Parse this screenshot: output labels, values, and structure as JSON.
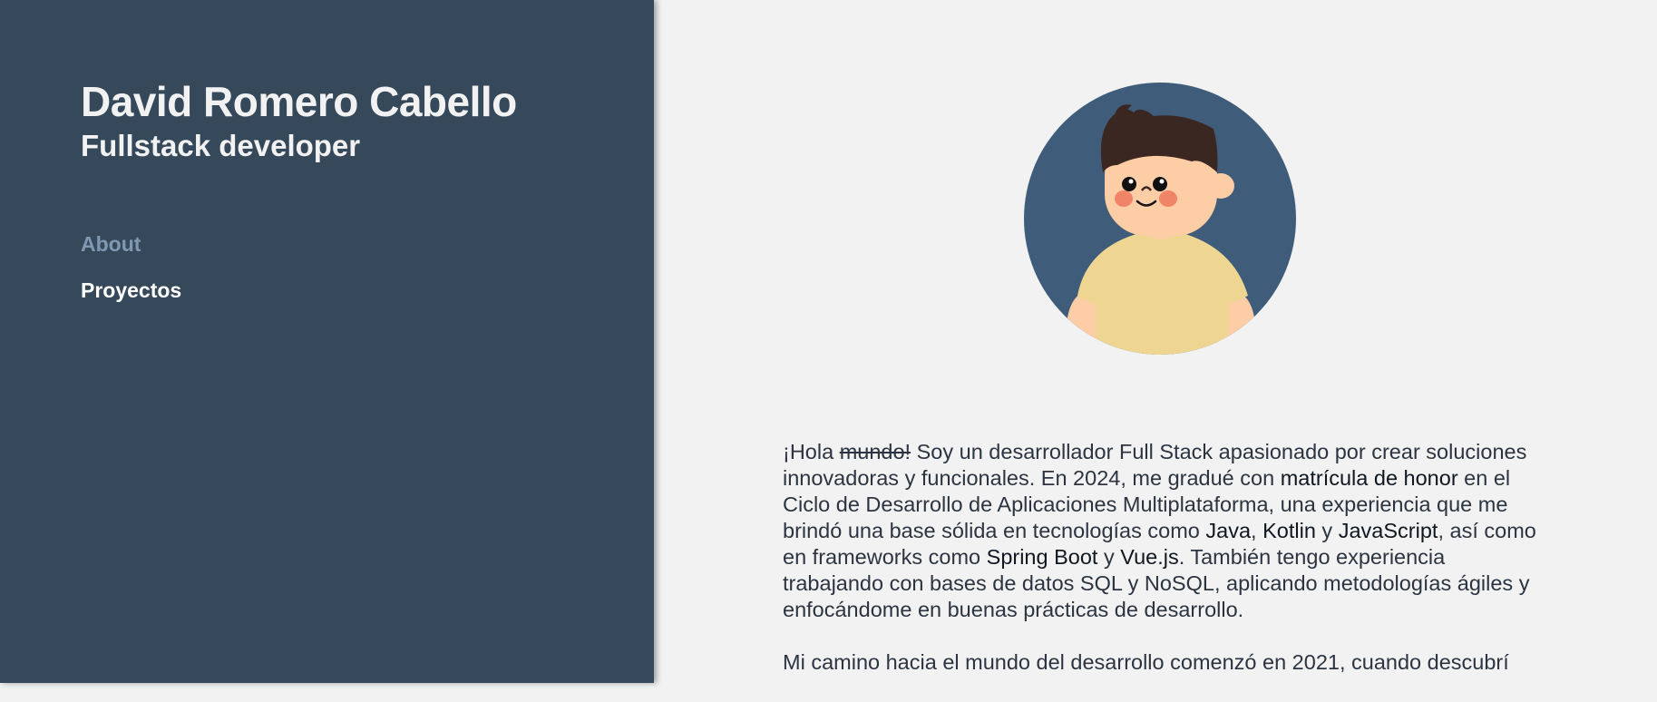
{
  "sidebar": {
    "name": "David Romero Cabello",
    "role": "Fullstack developer",
    "nav": [
      {
        "label": "About",
        "active": true
      },
      {
        "label": "Proyectos",
        "active": false
      }
    ]
  },
  "colors": {
    "sidebar_bg": "#36495b",
    "main_bg": "#f2f2f2",
    "active_nav": "#8198b2",
    "avatar_bg": "#3f5d7a"
  },
  "avatar": {
    "icon": "cartoon-boy-avatar"
  },
  "about": {
    "p1": {
      "s1": "¡Hola ",
      "s2": "mundo!",
      "s3": " Soy un desarrollador Full Stack apasionado por crear soluciones innovadoras y funcionales. En 2024, me gradué con ",
      "s4": "matrícula de honor",
      "s5": " en el Ciclo de Desarrollo de Aplicaciones Multiplataforma, una experiencia que me brindó una base sólida en tecnologías como ",
      "s6": "Java",
      "s7": ", ",
      "s8": "Kotlin",
      "s9": " y ",
      "s10": "JavaScript",
      "s11": ", así como en frameworks como ",
      "s12": "Spring Boot",
      "s13": " y ",
      "s14": "Vue.js",
      "s15": ". También tengo experiencia trabajando con bases de datos SQL y NoSQL, aplicando metodologías ágiles y enfocándome en buenas prácticas de desarrollo."
    },
    "p2": "Mi camino hacia el mundo del desarrollo comenzó en 2021, cuando descubrí"
  }
}
